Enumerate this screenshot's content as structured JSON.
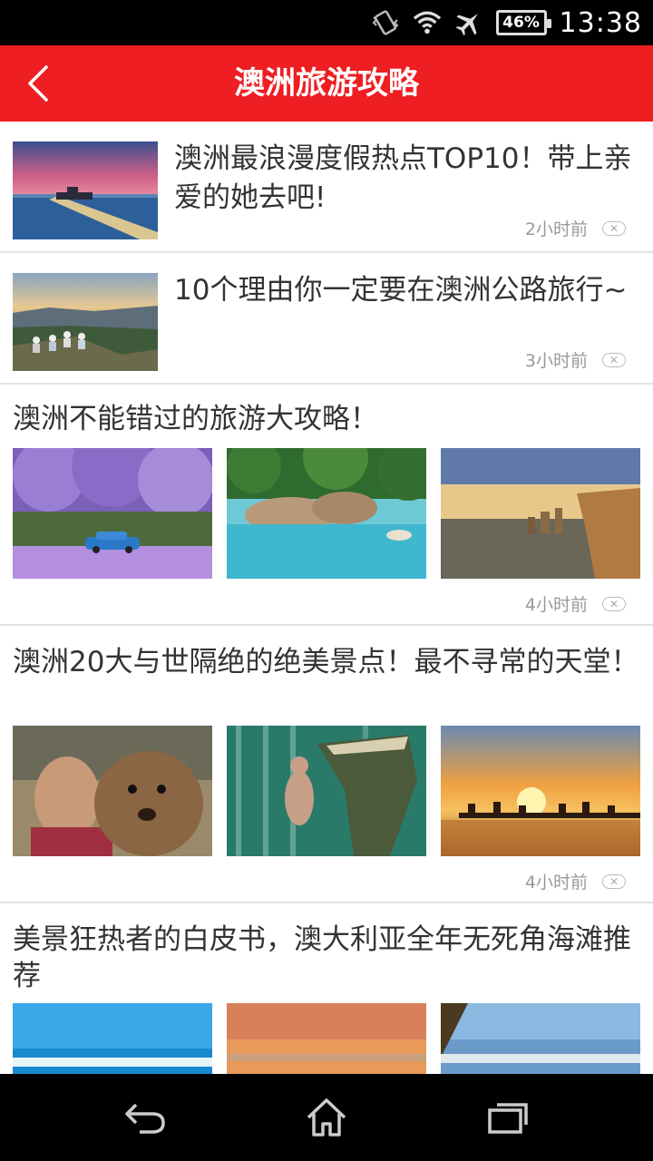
{
  "status_bar": {
    "battery_level": "46%",
    "time": "13:38",
    "icons": [
      "vibrate-icon",
      "wifi-icon",
      "airplane-icon",
      "battery-icon"
    ]
  },
  "header": {
    "title": "澳洲旅游攻略",
    "background": "#ee1e23"
  },
  "articles": [
    {
      "title": "澳洲最浪漫度假热点TOP10！带上亲爱的她去吧!",
      "time": "2小时前"
    },
    {
      "title": "10个理由你一定要在澳洲公路旅行~",
      "time": "3小时前"
    },
    {
      "title": "澳洲不能错过的旅游大攻略！",
      "time": "4小时前"
    },
    {
      "title": "澳洲20大与世隔绝的绝美景点！最不寻常的天堂！",
      "time": "4小时前"
    },
    {
      "title": "美景狂热者的白皮书，澳大利亚全年无死角海滩推荐",
      "time": ""
    }
  ],
  "dismiss_glyph": "✕",
  "nav_bar": {
    "buttons": [
      "back-icon",
      "home-icon",
      "recent-apps-icon"
    ]
  }
}
